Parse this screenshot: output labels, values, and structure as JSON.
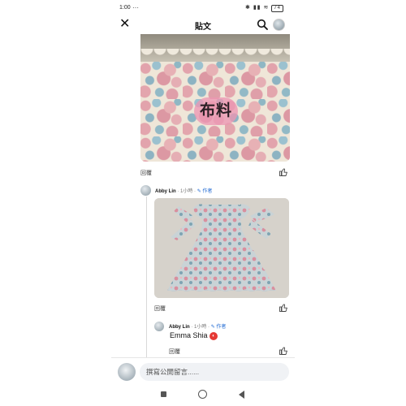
{
  "status_bar": {
    "time": "1:00",
    "extra": "⋯",
    "battery": "74"
  },
  "header": {
    "title": "貼文"
  },
  "post": {
    "image_label": "布料",
    "reply_label": "回覆"
  },
  "comment": {
    "name": "Abby Lin",
    "time": "· 1小時 ·",
    "author_badge": "作者",
    "reply_label": "回覆"
  },
  "reply": {
    "name": "Abby Lin",
    "time": "· 1小時 ·",
    "author_badge": "作者",
    "text": "Emma Shia",
    "reply_label": "回覆"
  },
  "composer": {
    "placeholder": "撰寫公開留言......"
  },
  "colors": {
    "author_blue": "#1a66d2",
    "composer_bg": "#f0f2f5"
  }
}
